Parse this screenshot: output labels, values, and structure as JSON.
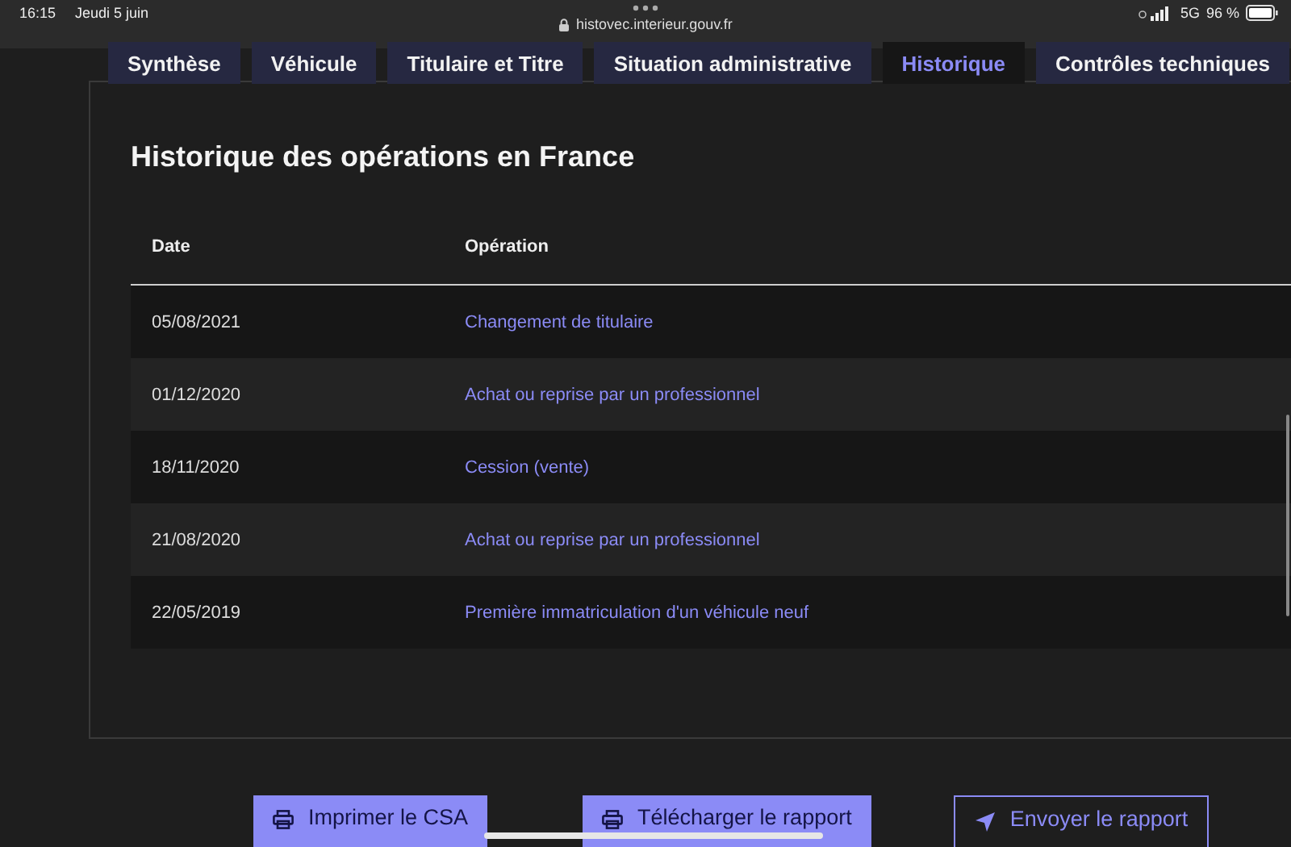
{
  "status_bar": {
    "time": "16:15",
    "date": "Jeudi 5 juin",
    "url": "histovec.interieur.gouv.fr",
    "network": "5G",
    "battery": "96 %"
  },
  "tabs": [
    {
      "label": "Synthèse",
      "selected": false
    },
    {
      "label": "Véhicule",
      "selected": false
    },
    {
      "label": "Titulaire et Titre",
      "selected": false
    },
    {
      "label": "Situation administrative",
      "selected": false
    },
    {
      "label": "Historique",
      "selected": true
    },
    {
      "label": "Contrôles techniques",
      "selected": false
    }
  ],
  "section": {
    "title": "Historique des opérations en France"
  },
  "table": {
    "columns": [
      "Date",
      "Opération"
    ],
    "rows": [
      [
        "05/08/2021",
        "Changement de titulaire"
      ],
      [
        "01/12/2020",
        "Achat ou reprise par un professionnel"
      ],
      [
        "18/11/2020",
        "Cession (vente)"
      ],
      [
        "21/08/2020",
        "Achat ou reprise par un professionnel"
      ],
      [
        "22/05/2019",
        "Première immatriculation d'un véhicule neuf"
      ]
    ]
  },
  "actions": [
    {
      "label": "Imprimer le CSA",
      "kind": "print"
    },
    {
      "label": "Télécharger le rapport",
      "kind": "print"
    },
    {
      "label": "Envoyer le rapport",
      "kind": "send"
    }
  ]
}
